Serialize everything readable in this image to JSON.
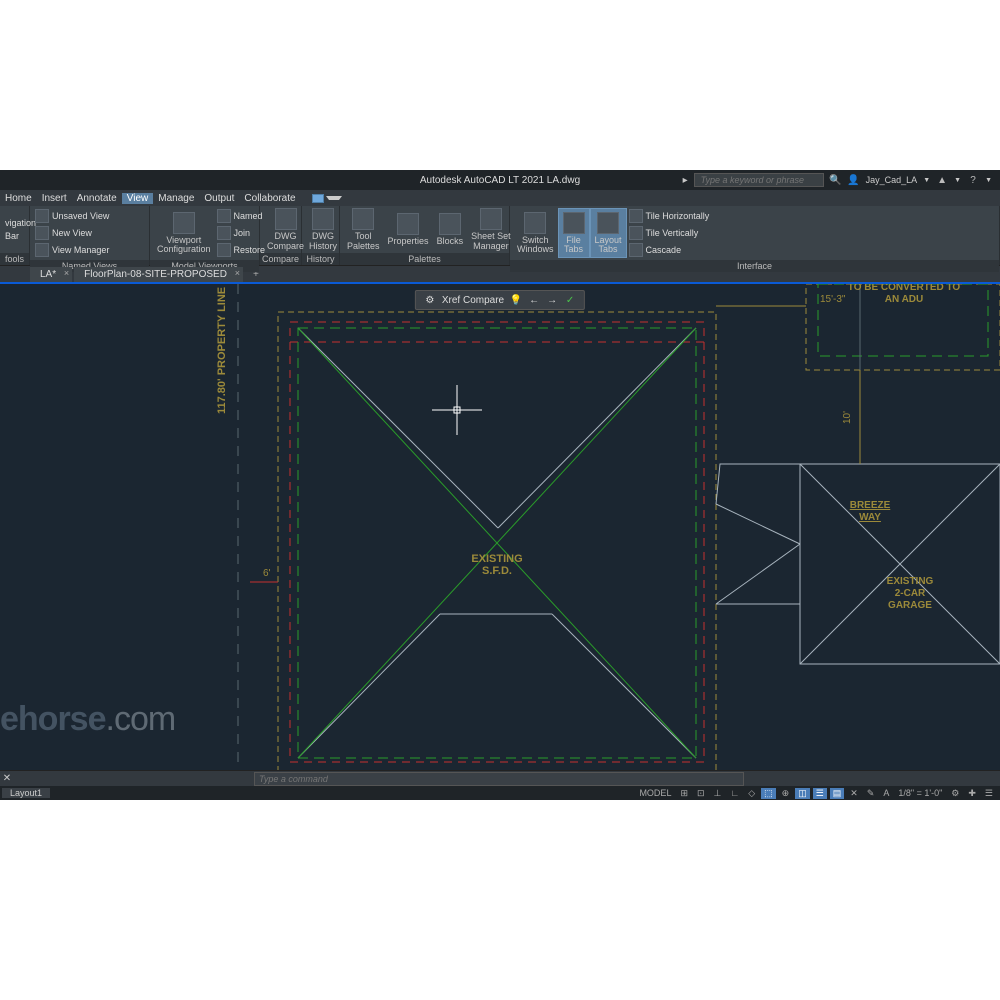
{
  "title": "Autodesk AutoCAD LT 2021    LA.dwg",
  "search": {
    "placeholder": "Type a keyword or phrase",
    "icon": "🔍"
  },
  "user": "Jay_Cad_LA",
  "menu": [
    "Home",
    "Insert",
    "Annotate",
    "View",
    "Manage",
    "Output",
    "Collaborate"
  ],
  "menu_active": 3,
  "ribbon": {
    "nav": {
      "title": "",
      "items": [
        "vigation",
        "Bar",
        "fools"
      ]
    },
    "views": {
      "title": "Named Views",
      "unsaved": "Unsaved View",
      "items": [
        "New View",
        "View Manager"
      ]
    },
    "vp": {
      "title": "Model Viewports",
      "big": "Viewport\nConfiguration",
      "items": [
        "Named",
        "Join",
        "Restore"
      ]
    },
    "compare": {
      "title": "Compare",
      "big": "DWG\nCompare"
    },
    "history": {
      "title": "History",
      "big": "DWG\nHistory"
    },
    "palettes": {
      "title": "Palettes",
      "items": [
        "Tool\nPalettes",
        "Properties",
        "Blocks",
        "Sheet Set\nManager"
      ]
    },
    "windows": {
      "title": "",
      "items": [
        "Switch\nWindows",
        "File\nTabs",
        "Layout\nTabs"
      ],
      "tile": [
        "Tile Horizontally",
        "Tile Vertically",
        "Cascade"
      ],
      "iface_title": "Interface"
    }
  },
  "file_tabs": [
    {
      "name": "LA*",
      "close": "×"
    },
    {
      "name": "FloorPlan-08-SITE-PROPOSED",
      "close": "×"
    }
  ],
  "file_tab_add": "+",
  "xref_bar": {
    "label": "Xref Compare",
    "gear": "⚙",
    "bulb": "💡",
    "left": "←",
    "right": "→",
    "check": "✓"
  },
  "drawing": {
    "prop_line": "117.80' PROPERTY LINE",
    "existing_sfd": "EXISTING\nS.F.D.",
    "breeze": "BREEZE",
    "way": "WAY",
    "garage": "EXISTING\n2-CAR\nGARAGE",
    "adu1": "TO BE CONVERTED TO",
    "adu2": "AN ADU",
    "dim1": "15'-3\"",
    "dim2": "6'",
    "dim3": "10'"
  },
  "cmdline": {
    "placeholder": "Type a command",
    "prefix": "▸",
    "x": "✕"
  },
  "status": {
    "layout": "Layout1",
    "model": "MODEL",
    "scale": "1/8\" = 1'-0\"",
    "icons": [
      "⊞",
      "⊡",
      "⊥",
      "∟",
      "◇",
      "⬚",
      "⊕",
      "◫",
      "☰",
      "▤",
      "✕",
      "✎",
      "A"
    ]
  },
  "watermark": {
    "a": "ehorse",
    "b": ".com"
  }
}
